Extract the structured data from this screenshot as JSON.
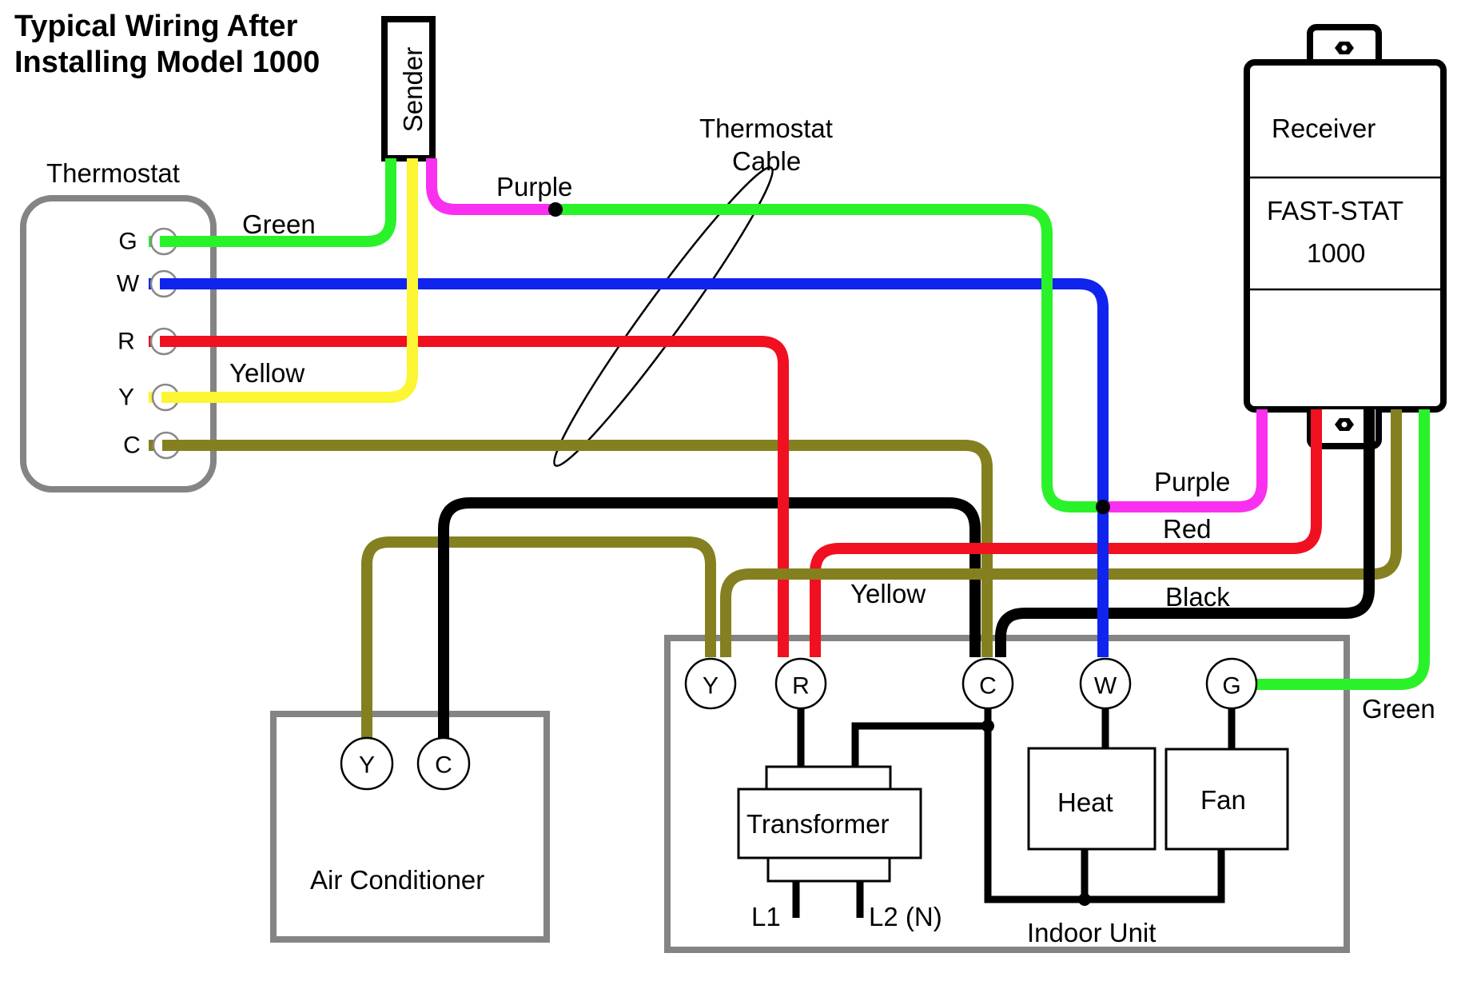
{
  "title": {
    "line1": "Typical Wiring After",
    "line2": "Installing Model 1000"
  },
  "colors": {
    "green": "#2af22a",
    "blue": "#1024ee",
    "red": "#f01020",
    "yellow": "#fbf533",
    "olive": "#848020",
    "purple": "#f930f0",
    "black": "#000000",
    "box_gray": "#848484"
  },
  "thermostat": {
    "label": "Thermostat",
    "terminals": [
      "G",
      "W",
      "R",
      "Y",
      "C"
    ]
  },
  "sender": {
    "label": "Sender"
  },
  "receiver": {
    "label": "Receiver",
    "model_line1": "FAST-STAT",
    "model_line2": "1000"
  },
  "cable_label": {
    "line1": "Thermostat",
    "line2": "Cable"
  },
  "wire_labels": {
    "green_top": "Green",
    "yellow_top": "Yellow",
    "purple_top": "Purple",
    "purple_right": "Purple",
    "red_right": "Red",
    "yellow_mid": "Yellow",
    "black_right": "Black",
    "green_right": "Green"
  },
  "air_conditioner": {
    "label": "Air Conditioner",
    "terminals": [
      "Y",
      "C"
    ]
  },
  "indoor_unit": {
    "label": "Indoor Unit",
    "terminals": [
      "Y",
      "R",
      "C",
      "W",
      "G"
    ],
    "transformer": "Transformer",
    "heat": "Heat",
    "fan": "Fan",
    "line1": "L1",
    "line2": "L2 (N)"
  }
}
